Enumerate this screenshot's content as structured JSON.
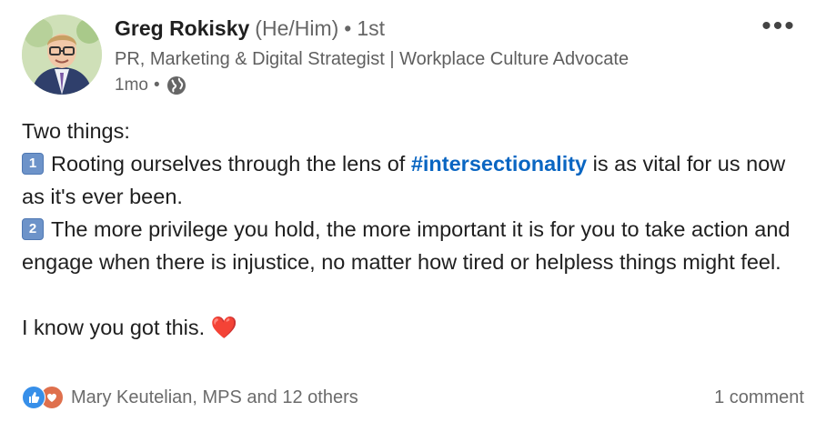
{
  "post": {
    "author": {
      "name": "Greg Rokisky",
      "pronouns": "(He/Him)",
      "degree": "1st",
      "headline": "PR, Marketing & Digital Strategist | Workplace Culture Advocate",
      "time": "1mo",
      "visibility_icon": "globe-icon"
    },
    "more_label": "•••",
    "body": {
      "intro": "Two things:",
      "point1_num": "1",
      "point1_pre": "Rooting ourselves through the lens of ",
      "point1_hashtag": "#intersectionality",
      "point1_post": " is as vital for us now as it's ever been.",
      "point2_num": "2",
      "point2": "The more privilege you hold, the more important it is for you to take action and engage when there is injustice, no matter how tired or helpless things might feel.",
      "closing": "I know you got this.",
      "closing_emoji": "❤️"
    },
    "social": {
      "reaction_icons": [
        "like-icon",
        "love-icon"
      ],
      "reactions_text": "Mary Keutelian, MPS and 12 others",
      "comments_text": "1 comment"
    },
    "colors": {
      "link": "#0a66c2",
      "like": "#378fe9",
      "love": "#df704d",
      "heart": "#e11d33"
    }
  }
}
